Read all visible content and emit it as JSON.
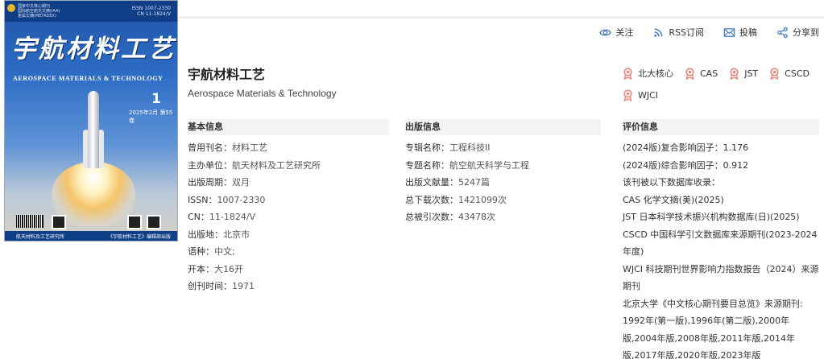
{
  "cover": {
    "title_cn": "宇航材料工艺",
    "title_en": "AEROSPACE MATERIALS & TECHNOLOGY",
    "issue_number": "1",
    "issue_date": "2025年2月 第55卷",
    "index_lines": [
      "国家中文核心期刊",
      "国际航空航天文摘(IAA)",
      "金属文摘(METADEX)"
    ],
    "issn_lines": [
      "ISSN 1007-2330",
      "CN 11-1824/V"
    ],
    "publisher_left": "航天材料及工艺研究所",
    "publisher_right": "《宇航材料工艺》编辑部出版"
  },
  "toolbar": {
    "follow": "关注",
    "rss": "RSS订阅",
    "submit": "投稿",
    "share": "分享到"
  },
  "journal": {
    "title": "宇航材料工艺",
    "title_en": "Aerospace Materials & Technology"
  },
  "badges": [
    "北大核心",
    "CAS",
    "JST",
    "CSCD",
    "WJCI"
  ],
  "basic": {
    "heading": "基本信息",
    "rows": [
      {
        "k": "曾用刊名：",
        "v": "材料工艺"
      },
      {
        "k": "主办单位：",
        "v": "航天材料及工艺研究所"
      },
      {
        "k": "出版周期：",
        "v": "双月"
      },
      {
        "k": "ISSN：",
        "v": "1007-2330"
      },
      {
        "k": "CN：",
        "v": "11-1824/V"
      },
      {
        "k": "出版地：",
        "v": "北京市"
      },
      {
        "k": "语种：",
        "v": "中文;"
      },
      {
        "k": "开本：",
        "v": "大16开"
      },
      {
        "k": "创刊时间：",
        "v": "1971"
      }
    ]
  },
  "publish": {
    "heading": "出版信息",
    "rows": [
      {
        "k": "专辑名称：",
        "v": "工程科技II"
      },
      {
        "k": "专题名称：",
        "v": "航空航天科学与工程"
      },
      {
        "k": "出版文献量：",
        "v": "5247篇"
      },
      {
        "k": "总下载次数：",
        "v": "1421099次"
      },
      {
        "k": "总被引次数：",
        "v": "43478次"
      }
    ]
  },
  "evaluation": {
    "heading": "评价信息",
    "rows": [
      "(2024版)复合影响因子：1.176",
      "(2024版)综合影响因子：0.912",
      "该刊被以下数据库收录：",
      "CAS 化学文摘(美)(2025)",
      "JST 日本科学技术振兴机构数据库(日)(2025)",
      "CSCD 中国科学引文数据库来源期刊(2023-2024年度)",
      "WJCI 科技期刊世界影响力指数报告（2024）来源期刊",
      "北京大学《中文核心期刊要目总览》来源期刊:",
      "1992年(第一版),1996年(第二版),2000年版,2004年版,2008年版,2011年版,2014年版,2017年版,2020年版,2023年版"
    ]
  },
  "colors": {
    "accent": "#4a7fc1",
    "badge": "#e8847a",
    "section_bg": "#f3f3f3"
  }
}
